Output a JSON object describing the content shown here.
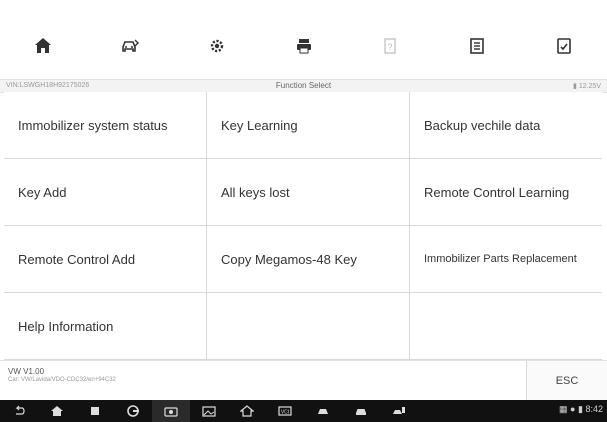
{
  "toolbar": {
    "buttons": [
      {
        "name": "home-icon"
      },
      {
        "name": "vehicle-swap-icon"
      },
      {
        "name": "settings-icon"
      },
      {
        "name": "print-icon"
      },
      {
        "name": "help-icon"
      },
      {
        "name": "save-icon"
      },
      {
        "name": "data-log-icon"
      }
    ]
  },
  "status": {
    "vin": "VIN:LSWGH18H92175026",
    "title": "Function Select",
    "voltage": "12.25V"
  },
  "menu": [
    "Immobilizer system status",
    "Key Learning",
    "Backup vechile data",
    "Key Add",
    "All keys lost",
    "Remote Control Learning",
    "Remote Control Add",
    "Copy Megamos-48 Key",
    "Immobilizer Parts Replacement",
    "Help Information",
    "",
    ""
  ],
  "footer": {
    "model": "VW V1.00",
    "path": "Car: VW/Lavida/VDO-CDC32/en+94C32",
    "esc_label": "ESC"
  },
  "system": {
    "clock": "8:42"
  }
}
